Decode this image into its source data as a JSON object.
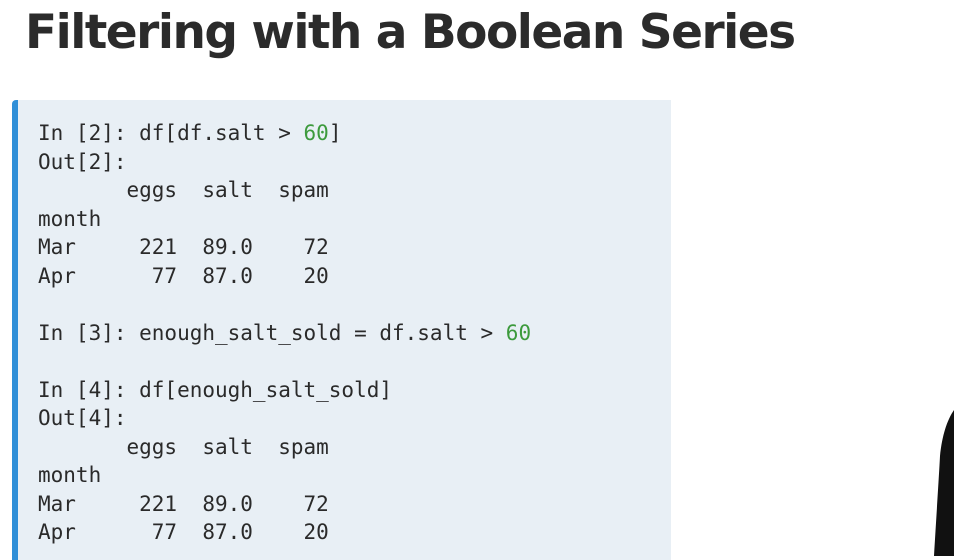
{
  "slide": {
    "title": "Filtering with a Boolean Series"
  },
  "code": {
    "line1": {
      "prefix": "In [2]: df[df.salt > ",
      "number": "60",
      "suffix": "]"
    },
    "line2": "Out[2]:",
    "line3": "       eggs  salt  spam",
    "line4": "month",
    "line5": "Mar     221  89.0    72",
    "line6": "Apr      77  87.0    20",
    "line7": "",
    "line8": {
      "prefix": "In [3]: enough_salt_sold = df.salt > ",
      "number": "60",
      "suffix": ""
    },
    "line9": "",
    "line10": "In [4]: df[enough_salt_sold]",
    "line11": "Out[4]:",
    "line12": "       eggs  salt  spam",
    "line13": "month",
    "line14": "Mar     221  89.0    72",
    "line15": "Apr      77  87.0    20"
  },
  "colors": {
    "accent_bar": "#2f8fd8",
    "code_background": "#e8eff5",
    "number_literal": "#3c9a3c",
    "title_text": "#2b2b2b"
  }
}
